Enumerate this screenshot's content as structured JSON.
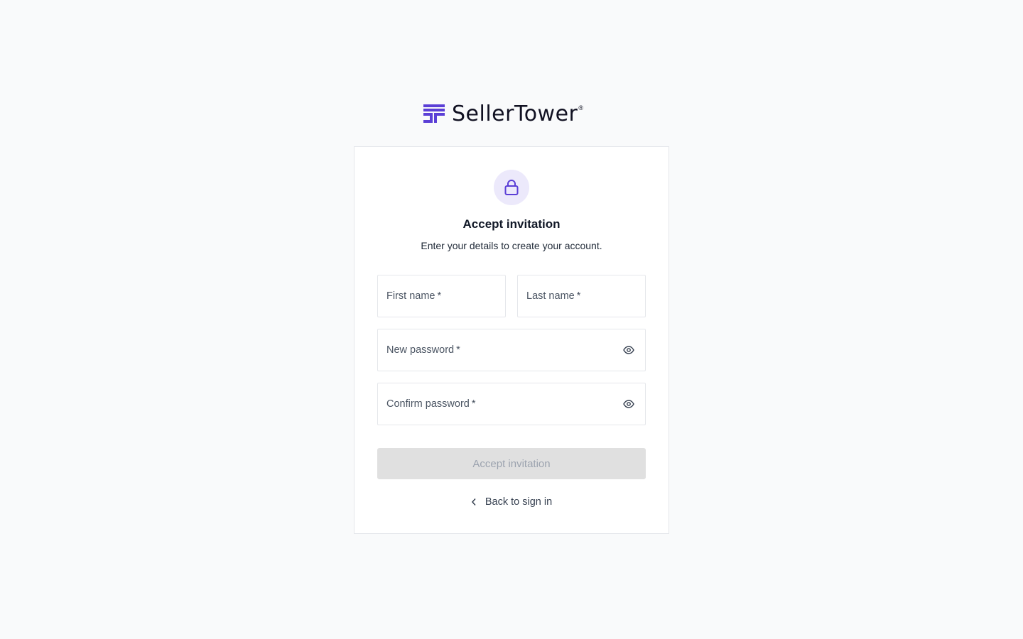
{
  "brand": {
    "name": "SellerTower",
    "registered_mark": "®",
    "accent_color": "#5b3fd6",
    "logo_icon": "sellertower-logo-mark"
  },
  "card": {
    "icon": "lock-icon",
    "title": "Accept invitation",
    "subtitle": "Enter your details to create your account."
  },
  "form": {
    "first_name": {
      "label": "First name",
      "required_marker": "*",
      "value": ""
    },
    "last_name": {
      "label": "Last name",
      "required_marker": "*",
      "value": ""
    },
    "new_password": {
      "label": "New password",
      "required_marker": "*",
      "value": "",
      "toggle_icon": "eye-icon"
    },
    "confirm_password": {
      "label": "Confirm password",
      "required_marker": "*",
      "value": "",
      "toggle_icon": "eye-icon"
    },
    "submit_label": "Accept invitation",
    "submit_disabled": true
  },
  "footer": {
    "back_label": "Back to sign in",
    "back_icon": "chevron-left-icon"
  }
}
